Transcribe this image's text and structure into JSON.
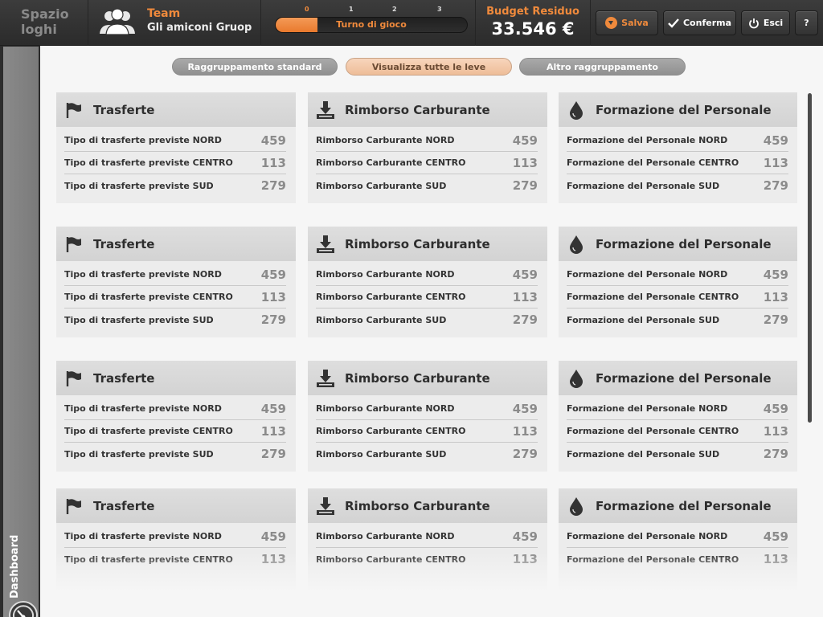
{
  "app": {
    "logo_line1": "Spazio",
    "logo_line2": "loghi"
  },
  "team": {
    "label": "Team",
    "name": "Gli amiconi Gruop"
  },
  "turn": {
    "steps": [
      "0",
      "1",
      "2",
      "3"
    ],
    "active_step": 0,
    "label": "Turno di gioco",
    "progress": 0.22
  },
  "budget": {
    "label": "Budget Residuo",
    "value": "33.546 €"
  },
  "toolbar": {
    "save": "Salva",
    "confirm": "Conferma",
    "exit": "Esci",
    "help": "?"
  },
  "sidebar": {
    "dashboard_label": "Dashboard"
  },
  "filters": [
    {
      "label": "Raggruppamento standard",
      "active": false
    },
    {
      "label": "Visualizza tutte le leve",
      "active": true
    },
    {
      "label": "Altro raggruppamento",
      "active": false
    }
  ],
  "grid": [
    [
      {
        "icon": "flag-icon",
        "title": "Trasferte",
        "rows": [
          {
            "label": "Tipo di trasferte previste NORD",
            "value": "459"
          },
          {
            "label": "Tipo di trasferte previste CENTRO",
            "value": "113"
          },
          {
            "label": "Tipo di trasferte previste SUD",
            "value": "279"
          }
        ]
      },
      {
        "icon": "download-tray-icon",
        "title": "Rimborso Carburante",
        "rows": [
          {
            "label": "Rimborso Carburante NORD",
            "value": "459"
          },
          {
            "label": "Rimborso Carburante CENTRO",
            "value": "113"
          },
          {
            "label": "Rimborso Carburante SUD",
            "value": "279"
          }
        ]
      },
      {
        "icon": "drop-icon",
        "title": "Formazione del Personale",
        "rows": [
          {
            "label": "Formazione del Personale NORD",
            "value": "459"
          },
          {
            "label": "Formazione del Personale CENTRO",
            "value": "113"
          },
          {
            "label": "Formazione del Personale SUD",
            "value": "279"
          }
        ]
      }
    ],
    [
      {
        "icon": "flag-icon",
        "title": "Trasferte",
        "rows": [
          {
            "label": "Tipo di trasferte previste NORD",
            "value": "459"
          },
          {
            "label": "Tipo di trasferte previste CENTRO",
            "value": "113"
          },
          {
            "label": "Tipo di trasferte previste SUD",
            "value": "279"
          }
        ]
      },
      {
        "icon": "download-tray-icon",
        "title": "Rimborso Carburante",
        "rows": [
          {
            "label": "Rimborso Carburante NORD",
            "value": "459"
          },
          {
            "label": "Rimborso Carburante CENTRO",
            "value": "113"
          },
          {
            "label": "Rimborso Carburante SUD",
            "value": "279"
          }
        ]
      },
      {
        "icon": "drop-icon",
        "title": "Formazione del Personale",
        "rows": [
          {
            "label": "Formazione del Personale NORD",
            "value": "459"
          },
          {
            "label": "Formazione del Personale CENTRO",
            "value": "113"
          },
          {
            "label": "Formazione del Personale SUD",
            "value": "279"
          }
        ]
      }
    ],
    [
      {
        "icon": "flag-icon",
        "title": "Trasferte",
        "rows": [
          {
            "label": "Tipo di trasferte previste NORD",
            "value": "459"
          },
          {
            "label": "Tipo di trasferte previste CENTRO",
            "value": "113"
          },
          {
            "label": "Tipo di trasferte previste SUD",
            "value": "279"
          }
        ]
      },
      {
        "icon": "download-tray-icon",
        "title": "Rimborso Carburante",
        "rows": [
          {
            "label": "Rimborso Carburante NORD",
            "value": "459"
          },
          {
            "label": "Rimborso Carburante CENTRO",
            "value": "113"
          },
          {
            "label": "Rimborso Carburante SUD",
            "value": "279"
          }
        ]
      },
      {
        "icon": "drop-icon",
        "title": "Formazione del Personale",
        "rows": [
          {
            "label": "Formazione del Personale NORD",
            "value": "459"
          },
          {
            "label": "Formazione del Personale CENTRO",
            "value": "113"
          },
          {
            "label": "Formazione del Personale SUD",
            "value": "279"
          }
        ]
      }
    ],
    [
      {
        "icon": "flag-icon",
        "title": "Trasferte",
        "rows": [
          {
            "label": "Tipo di trasferte previste NORD",
            "value": "459"
          },
          {
            "label": "Tipo di trasferte previste CENTRO",
            "value": "113"
          }
        ]
      },
      {
        "icon": "download-tray-icon",
        "title": "Rimborso Carburante",
        "rows": [
          {
            "label": "Rimborso Carburante NORD",
            "value": "459"
          },
          {
            "label": "Rimborso Carburante CENTRO",
            "value": "113"
          }
        ]
      },
      {
        "icon": "drop-icon",
        "title": "Formazione del Personale",
        "rows": [
          {
            "label": "Formazione del Personale NORD",
            "value": "459"
          },
          {
            "label": "Formazione del Personale CENTRO",
            "value": "113"
          }
        ]
      }
    ]
  ]
}
